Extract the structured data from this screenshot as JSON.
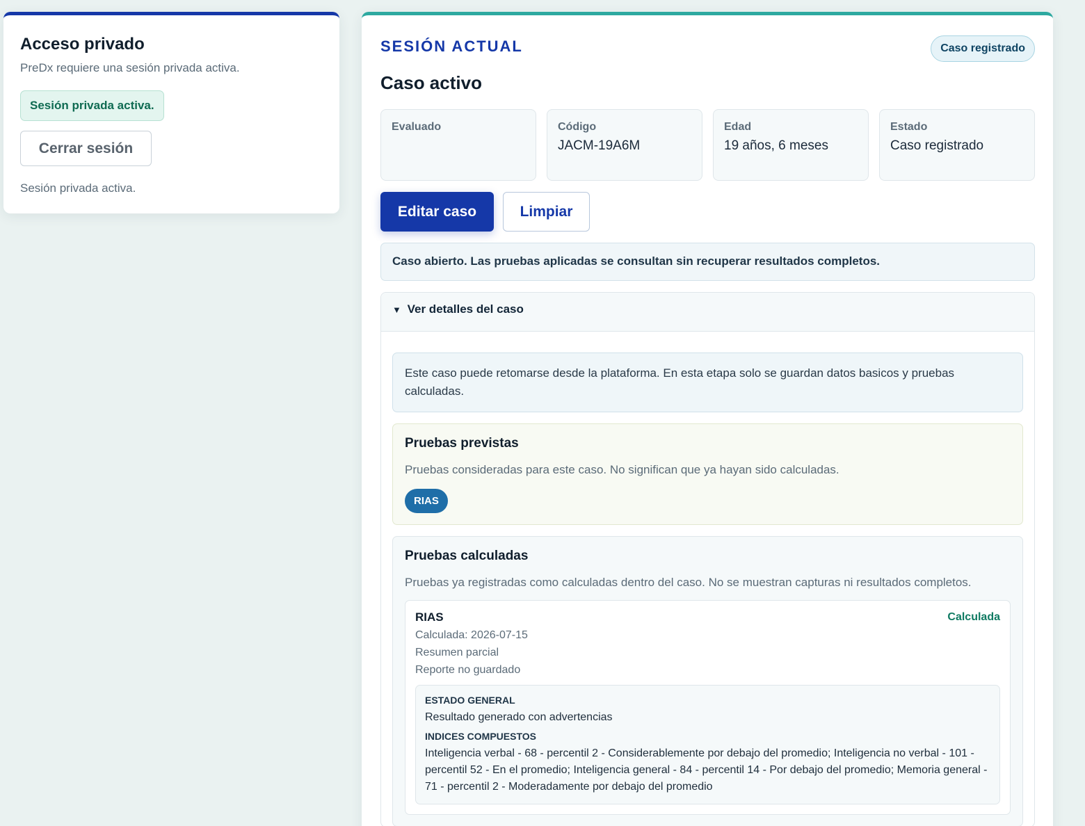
{
  "access": {
    "title": "Acceso privado",
    "subtitle": "PreDx requiere una sesión privada activa.",
    "active_pill": "Sesión privada activa.",
    "logout_label": "Cerrar sesión",
    "footnote": "Sesión privada activa."
  },
  "session": {
    "eyebrow": "SESIÓN ACTUAL",
    "badge": "Caso registrado",
    "title": "Caso activo",
    "stats": [
      {
        "label": "Evaluado",
        "value": ""
      },
      {
        "label": "Código",
        "value": "JACM-19A6M"
      },
      {
        "label": "Edad",
        "value": "19 años, 6 meses"
      },
      {
        "label": "Estado",
        "value": "Caso registrado"
      }
    ],
    "edit_label": "Editar caso",
    "clear_label": "Limpiar",
    "notice": "Caso abierto. Las pruebas aplicadas se consultan sin recuperar resultados completos.",
    "details": {
      "summary": "Ver detalles del caso",
      "info": "Este caso puede retomarse desde la plataforma. En esta etapa solo se guardan datos basicos y pruebas calculadas.",
      "planned": {
        "title": "Pruebas previstas",
        "desc": "Pruebas consideradas para este caso. No significan que ya hayan sido calculadas.",
        "tags": [
          "RIAS"
        ]
      },
      "calculated": {
        "title": "Pruebas calculadas",
        "desc": "Pruebas ya registradas como calculadas dentro del caso. No se muestran capturas ni resultados completos.",
        "results": [
          {
            "name": "RIAS",
            "status": "Calculada",
            "date": "Calculada: 2026-07-15",
            "summary_type": "Resumen parcial",
            "report": "Reporte no guardado",
            "general_heading": "ESTADO GENERAL",
            "general_text": "Resultado generado con advertencias",
            "indices_heading": "INDICES COMPUESTOS",
            "indices_text": "Inteligencia verbal - 68 - percentil 2 - Considerablemente por debajo del promedio; Inteligencia no verbal - 101 - percentil 52 - En el promedio; Inteligencia general - 84 - percentil 14 - Por debajo del promedio; Memoria general - 71 - percentil 2 - Moderadamente por debajo del promedio"
          }
        ]
      }
    }
  },
  "colors": {
    "primary": "#1538a8",
    "accent_teal": "#2da9a0",
    "success": "#0f7a62",
    "background": "#eaf2f1"
  }
}
